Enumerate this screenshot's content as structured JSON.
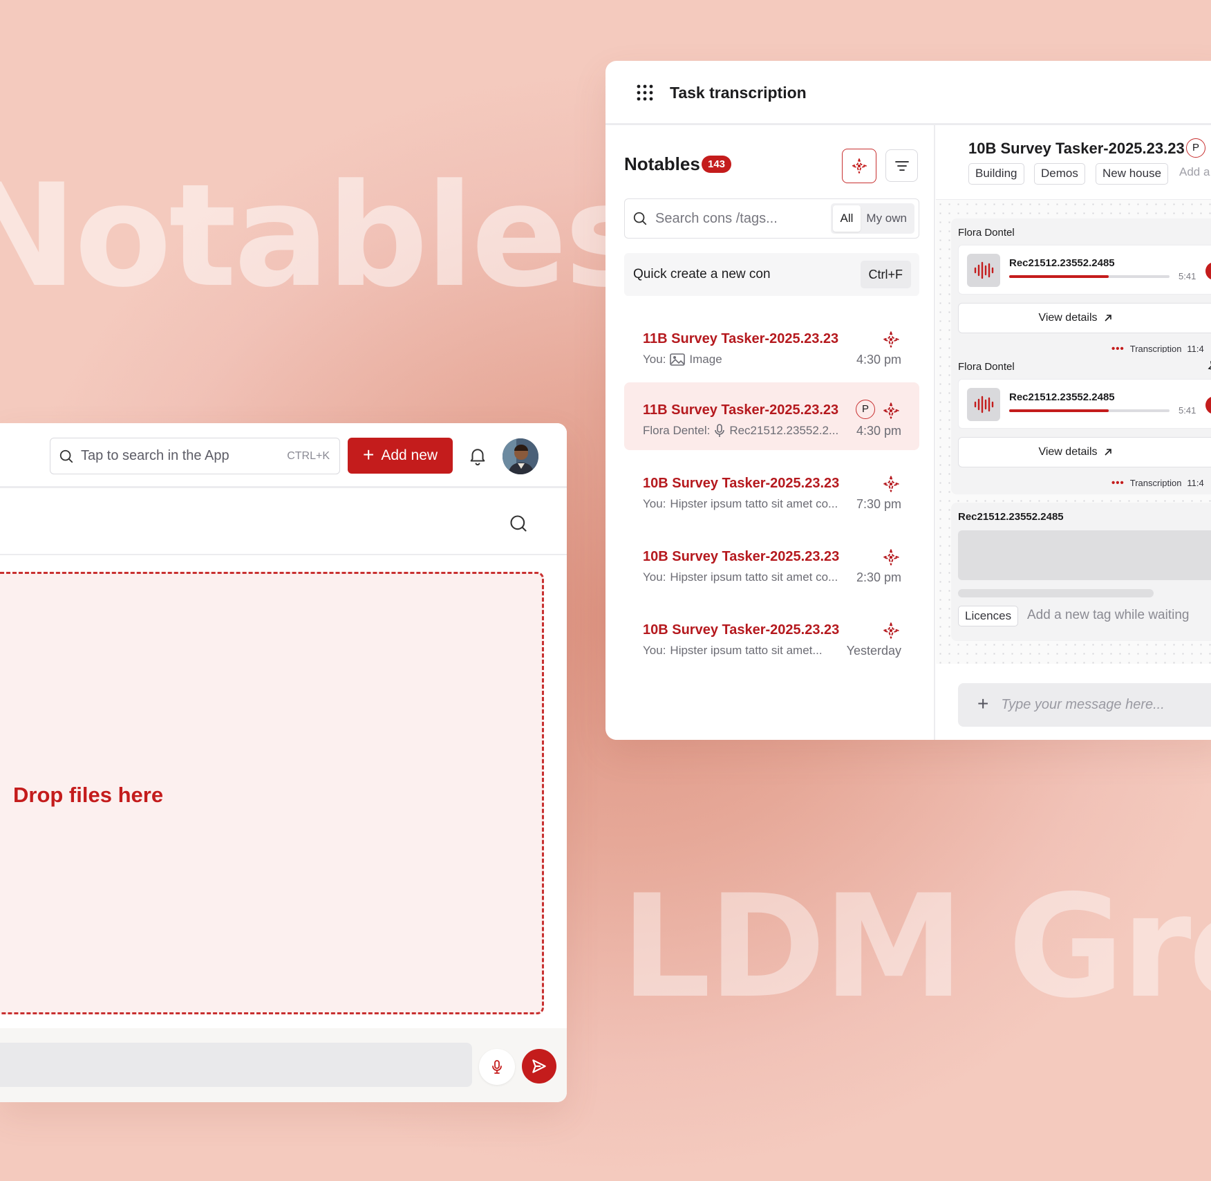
{
  "background": {
    "word_top": "Notables",
    "word_bottom": "LDM Grou"
  },
  "colors": {
    "accent": "#c41c1c",
    "background": "#e6a898"
  },
  "left_window": {
    "search": {
      "placeholder": "Tap to search in the App",
      "shortcut": "CTRL+K",
      "icon": "search-icon"
    },
    "add_new_label": "Add new",
    "dropzone_label": "Drop files here",
    "icons": [
      "search-icon",
      "plus-icon",
      "bell-icon",
      "avatar",
      "mic-icon",
      "send-icon"
    ]
  },
  "right_window": {
    "title": "Task transcription",
    "notables": {
      "title": "Notables",
      "count": "143",
      "search_placeholder": "Search cons /tags...",
      "segment": [
        "All",
        "My own"
      ],
      "segment_selected": "All",
      "quick_create": {
        "label": "Quick create a new con",
        "shortcut": "Ctrl+F"
      },
      "cons": [
        {
          "title": "11B Survey Tasker-2025.23.23",
          "sender": "You:",
          "preview": "Image",
          "preview_icon": "image-icon",
          "time": "4:30 pm",
          "priority": "",
          "selected": false
        },
        {
          "title": "11B Survey Tasker-2025.23.23",
          "sender": "Flora Dentel:",
          "preview": "Rec21512.23552.2...",
          "preview_icon": "mic-icon",
          "time": "4:30 pm",
          "priority": "P",
          "selected": true
        },
        {
          "title": "10B Survey Tasker-2025.23.23",
          "sender": "You:",
          "preview": "Hipster ipsum tatto sit amet co...",
          "preview_icon": "",
          "time": "7:30 pm",
          "priority": "",
          "selected": false
        },
        {
          "title": "10B Survey Tasker-2025.23.23",
          "sender": "You:",
          "preview": "Hipster ipsum tatto sit amet co...",
          "preview_icon": "",
          "time": "2:30 pm",
          "priority": "",
          "selected": false
        },
        {
          "title": "10B Survey Tasker-2025.23.23",
          "sender": "You:",
          "preview": "Hipster ipsum tatto sit amet...",
          "preview_icon": "",
          "time": "Yesterday",
          "priority": "",
          "selected": false
        }
      ]
    },
    "conversation": {
      "title": "10B Survey Tasker-2025.23.23",
      "priority": "P",
      "tags": [
        "Building",
        "Demos",
        "New house"
      ],
      "add_tag_label": "Add a",
      "messages": [
        {
          "sender": "Flora Dontel",
          "recording": "Rec21512.23552.2485",
          "duration": "5:41",
          "progress": 0.62,
          "view_label": "View details",
          "status": "Transcription",
          "time": "11:4"
        },
        {
          "sender": "Flora Dontel",
          "recording": "Rec21512.23552.2485",
          "duration": "5:41",
          "progress": 0.62,
          "view_label": "View details",
          "status": "Transcription",
          "time": "11:4"
        }
      ],
      "pending": {
        "recording": "Rec21512.23552.2485",
        "tag": "Licences",
        "tag_placeholder": "Add a new tag while waiting"
      },
      "composer_placeholder": "Type your message here..."
    }
  }
}
